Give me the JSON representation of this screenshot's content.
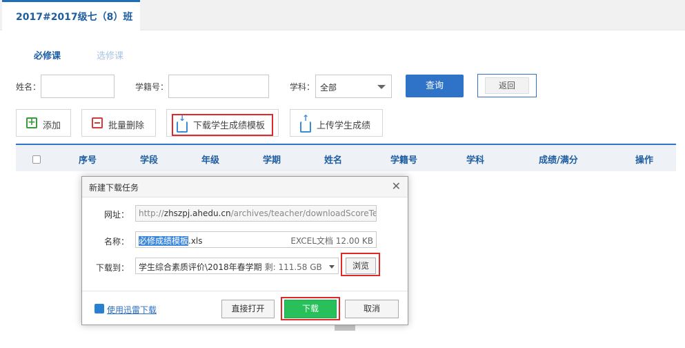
{
  "class_tab": "2017#2017级七（8）班",
  "sub_tabs": {
    "required": "必修课",
    "elective": "选修课"
  },
  "filters": {
    "name_label": "姓名：",
    "student_id_label": "学籍号：",
    "subject_label": "学科：",
    "subject_value": "全部",
    "query_button": "查询",
    "back_button": "返回"
  },
  "actions": {
    "add": "添加",
    "batch_delete": "批量删除",
    "download_template": "下载学生成绩模板",
    "upload_scores": "上传学生成绩"
  },
  "table": {
    "headers": [
      "序号",
      "学段",
      "年级",
      "学期",
      "姓名",
      "学籍号",
      "学科",
      "成绩/满分",
      "操作"
    ]
  },
  "dialog": {
    "title": "新建下载任务",
    "url_label": "网址：",
    "url_prefix": "http://",
    "url_domain": "zhszpj.ahedu.cn",
    "url_path": "/archives/teacher/downloadScoreTer",
    "name_label": "名称：",
    "file_name_selected": "必修成绩模板",
    "file_ext": ".xls",
    "file_meta": "EXCEL文档 12.00 KB",
    "save_label": "下载到：",
    "save_path": "学生综合素质评价\\2018年春学期",
    "free_space": "剩: 111.58 GB",
    "browse_button": "浏览",
    "thunder_link": "使用迅雷下载",
    "open_button": "直接打开",
    "download_button": "下载",
    "cancel_button": "取消"
  },
  "colors": {
    "accent": "#2f73c8",
    "highlight": "#e0282b",
    "download_green": "#27c05a"
  }
}
